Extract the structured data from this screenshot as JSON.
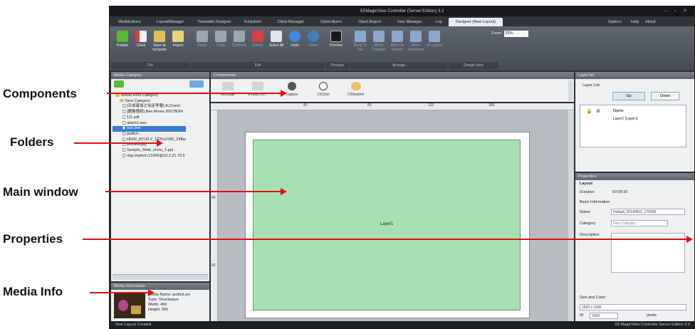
{
  "window": {
    "title": "SSMagicView Controller (Server Edition) 3.2",
    "controls": "–  ▫  ✕"
  },
  "tabs": [
    "MediaLibrary",
    "LayoutManager",
    "Timetable Designer",
    "Scheduler",
    "Client Manager",
    "Client Alarm",
    "Client Report",
    "User Manager",
    "Log",
    "Designer (New Layout)"
  ],
  "right_links": [
    "Options",
    "Help",
    "About"
  ],
  "ribbon": {
    "buttons": [
      {
        "label": "Publish",
        "icon": "check-icon",
        "color": "#5cb83a"
      },
      {
        "label": "Close",
        "icon": "close-doc-icon",
        "color": "#d94040"
      },
      {
        "label": "Save as template",
        "icon": "save-icon",
        "color": "#e0c050"
      },
      {
        "label": "Import",
        "icon": "import-icon",
        "color": "#e8d27a"
      },
      {
        "label": "Paste",
        "icon": "paste-icon",
        "color": "#9aa6b2"
      },
      {
        "label": "Copy",
        "icon": "copy-icon",
        "color": "#9aa6b2"
      },
      {
        "label": "Duplicate",
        "icon": "duplicate-icon",
        "color": "#9aa6b2"
      },
      {
        "label": "Delete",
        "icon": "delete-icon",
        "color": "#d64040"
      },
      {
        "label": "Select All",
        "icon": "select-all-icon",
        "color": "#dfe4ea"
      },
      {
        "label": "Undo",
        "icon": "undo-icon",
        "color": "#3c8ad8"
      },
      {
        "label": "Redo",
        "icon": "redo-icon",
        "color": "#3c8ad8"
      },
      {
        "label": "Preview",
        "icon": "preview-icon",
        "color": "#1a1a1a"
      },
      {
        "label": "Bring To Top",
        "icon": "bring-top-icon",
        "color": "#8aa9cc"
      },
      {
        "label": "Move Forward",
        "icon": "forward-icon",
        "color": "#8aa9cc"
      },
      {
        "label": "Move To Bottom",
        "icon": "bottom-icon",
        "color": "#8aa9cc"
      },
      {
        "label": "Move Backward",
        "icon": "backward-icon",
        "color": "#8aa9cc"
      },
      {
        "label": "Fit Layout",
        "icon": "fit-icon",
        "color": "#8aa9cc"
      }
    ],
    "groups": [
      "File",
      "Edit",
      "Preview",
      "Arrange",
      "Design View"
    ],
    "zoom_label": "Zoom",
    "zoom_value": "25%"
  },
  "media_category": {
    "title": "Media Category",
    "items": [
      {
        "label": "Media Root Category",
        "type": "folder"
      },
      {
        "label": "New Category",
        "type": "folder"
      },
      {
        "label": "[天成者加之仙臣等著].A.Cinem",
        "type": "file"
      },
      {
        "label": "[圖像傳說].Bee.Movie.2007BDRi",
        "type": "file"
      },
      {
        "label": "111.pdf",
        "type": "file"
      },
      {
        "label": "alarm1.wav",
        "type": "file"
      },
      {
        "label": "bee.bee",
        "type": "file"
      },
      {
        "label": "pudicti...",
        "type": "file"
      },
      {
        "label": "HD02_BTU0-2_1920x1080_29fbp",
        "type": "file"
      },
      {
        "label": "preview.jpg",
        "type": "file"
      },
      {
        "label": "Sample_Slide_show_1.ppt",
        "type": "file"
      },
      {
        "label": "rtsp://admin:12345@10.3.21.76:5",
        "type": "file"
      }
    ]
  },
  "media_info": {
    "title": "Media Information",
    "lines": [
      "Media Name: pudicti.avi",
      "Type: Shockwave",
      "Width: 450",
      "Height: 300"
    ]
  },
  "components": {
    "title": "Components",
    "items": [
      {
        "label": "Message",
        "icon": "message-icon"
      },
      {
        "label": "EmptyCon...",
        "icon": "empty-container-icon"
      },
      {
        "label": "Capture",
        "icon": "camera-icon"
      },
      {
        "label": "CIClock",
        "icon": "clock-icon"
      },
      {
        "label": "CIWeather",
        "icon": "weather-icon"
      }
    ]
  },
  "ruler": [
    "40",
    "80",
    "120",
    "160"
  ],
  "vruler": [
    "40",
    "80"
  ],
  "canvas": {
    "layer_label": "Layer1"
  },
  "layer_list": {
    "title": "Layer list",
    "label": "Layer List",
    "up_button": "Up",
    "down_button": "Down",
    "column_name": "Name",
    "rows": [
      "Layer1 (Layer1)"
    ]
  },
  "properties": {
    "title": "Properties",
    "layout": "Layout",
    "duration_label": "Duration",
    "duration_value": "00:00:30",
    "basic_info": "Basic Information",
    "name_label": "Name",
    "name_value": "Default_20140815_170439",
    "category_label": "Category",
    "category_value": "New Category",
    "description_label": "Description",
    "size_color": "Size and Color",
    "size_value": "1920 x 1080",
    "width_label": "W",
    "width_value": "1920",
    "height_label": "pixels"
  },
  "statusbar": {
    "left": "New Layout Created",
    "right": "SS MagicView Controller Server Edition 3.2"
  },
  "annotations": [
    "Components",
    "Folders",
    "Main window",
    "Properties",
    "Media Info"
  ]
}
